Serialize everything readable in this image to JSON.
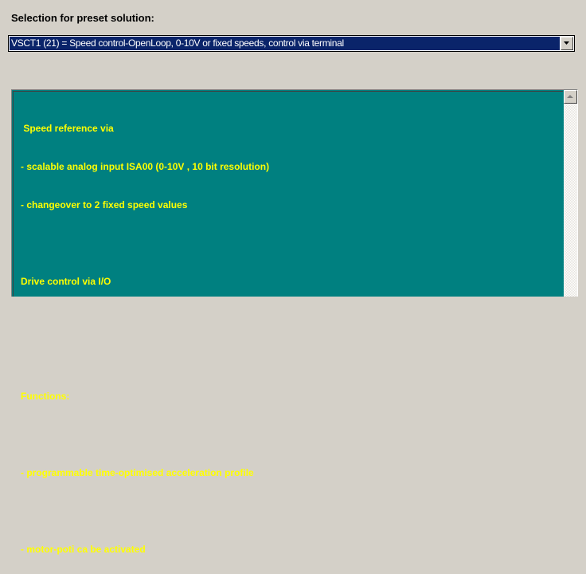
{
  "heading": "Selection for preset solution:",
  "preset_select": {
    "value": "VSCT1 (21) = Speed control-OpenLoop, 0-10V or fixed speeds, control via terminal",
    "arrow_icon": "chevron-down-icon"
  },
  "description": {
    "lines": [
      " Speed reference via",
      "- scalable analog input ISA00 (0-10V , 10 bit resolution)",
      "- changeover to 2 fixed speed values",
      "",
      "Drive control via I/O",
      "",
      "",
      "Functions:",
      "",
      "- programmable time-optimised acceleration profile",
      "",
      "- motor-poti ca be activated"
    ],
    "text_color": "#ffff00",
    "background_color": "#008080"
  },
  "colors": {
    "window_bg": "#d4d0c8",
    "selection_bg": "#0a246a"
  }
}
